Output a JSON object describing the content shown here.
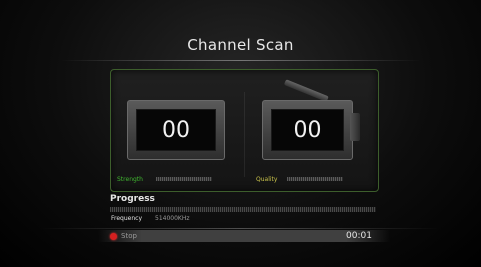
{
  "title": "Channel Scan",
  "meters": {
    "strength": {
      "value": "00",
      "label": "Strength",
      "level": 0
    },
    "quality": {
      "value": "00",
      "label": "Quality",
      "level": 0
    }
  },
  "progress": {
    "label": "Progress",
    "fraction": 0.0
  },
  "frequency": {
    "label": "Frequency",
    "value": "514000KHz"
  },
  "controls": {
    "stop_label": "Stop",
    "stop_color": "#d52020"
  },
  "timer": "00:01",
  "colors": {
    "strength_label": "#3fb52f",
    "quality_label": "#c8c24a",
    "panel_border": "#3d5e2c"
  },
  "icons": {
    "stop": "red-dot-icon",
    "tv": "tv-meter-icon",
    "radio": "radio-meter-icon"
  }
}
